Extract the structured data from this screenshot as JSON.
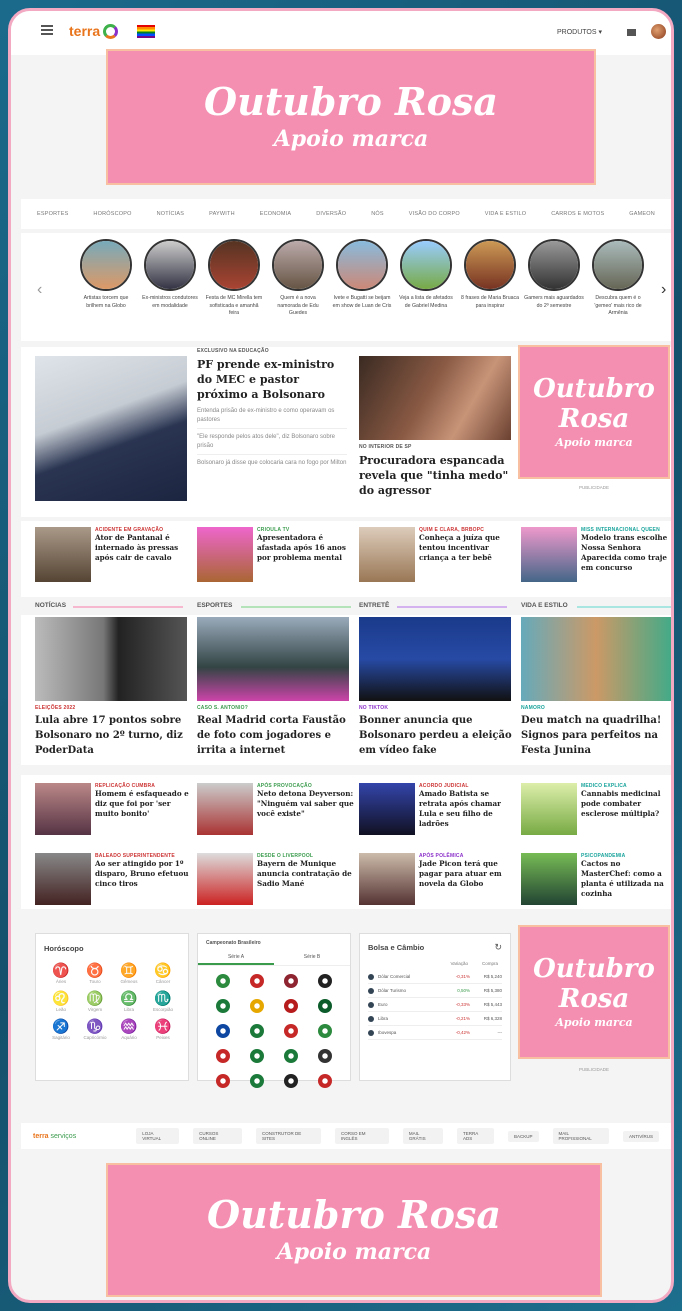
{
  "header": {
    "logo_text": "terra",
    "products_label": "PRODUTOS",
    "menu_icon": "hamburger-icon"
  },
  "promo": {
    "title": "Outubro Rosa",
    "subtitle": "Apoio marca"
  },
  "nav": [
    "ESPORTES",
    "HORÓSCOPO",
    "NOTÍCIAS",
    "PAYWITH",
    "ECONOMIA",
    "DIVERSÃO",
    "NÓS",
    "VISÃO DO CORPO",
    "VIDA E ESTILO",
    "CARROS E MOTOS",
    "GAMEON"
  ],
  "stories": [
    "Artistas torcem que brilhem na Globo",
    "Ex-ministros condutores em modalidade",
    "Festa de MC Mirella tem sofisticada e amanhã feira",
    "Quem é a nova namorada de Edu Guedes",
    "Ivete e Bugatti se beijam em show de Luan de Cris",
    "Veja a lista de afetados de Gabriel Medina",
    "8 frases de Maria Bruaca para inspirar",
    "Gamers mais aguardados do 2º semestre",
    "Descubra quem é o 'gemeo' mais rico de Armênia"
  ],
  "main": {
    "kicker": "EXCLUSIVO NA EDUCAÇÃO",
    "headline": "PF prende ex-ministro do MEC e pastor próximo a Bolsonaro",
    "bullets": [
      "Entenda prisão de ex-ministro e como operavam os pastores",
      "\"Ele responde pelos atos dele\", diz Bolsonaro sobre prisão",
      "Bolsonaro já disse que colocaria cara no fogo por Milton"
    ],
    "second_kicker": "NO INTERIOR DE SP",
    "second_headline": "Procuradora espancada revela que \"tinha medo\" do agressor",
    "ad_label": "PUBLICIDADE"
  },
  "row1": [
    {
      "kicker": "ACIDENTE EM GRAVAÇÃO",
      "title": "Ator de Pantanal é internado às pressas após cair de cavalo"
    },
    {
      "kicker": "CRIOULA TV",
      "title": "Apresentadora é afastada após 16 anos por problema mental"
    },
    {
      "kicker": "QUIM E CLARA, BRBOPC",
      "title": "Conheça a juíza que tentou incentivar criança a ter bebê"
    },
    {
      "kicker": "MISS INTERNACIONAL QUEEN",
      "title": "Modelo trans escolhe Nossa Senhora Aparecida como traje em concurso"
    }
  ],
  "sections": [
    "NOTÍCIAS",
    "ESPORTES",
    "ENTRETÊ",
    "VIDA E ESTILO"
  ],
  "features": [
    {
      "kicker": "ELEIÇÕES 2022",
      "title": "Lula abre 17 pontos sobre Bolsonaro no 2º turno, diz PoderData"
    },
    {
      "kicker": "CASO S. ANTONIO?",
      "title": "Real Madrid corta Faustão de foto com jogadores e irrita a internet"
    },
    {
      "kicker": "NO TIKTOK",
      "title": "Bonner anuncia que Bolsonaro perdeu a eleição em vídeo fake"
    },
    {
      "kicker": "NAMORO",
      "title": "Deu match na quadrilha! Signos para perfeitos na Festa Junina"
    }
  ],
  "row2": [
    {
      "kicker": "REPLICAÇÃO CUMBRA",
      "title": "Homem é esfaqueado e diz que foi por 'ser muito bonito'"
    },
    {
      "kicker": "APÓS PROVOCAÇÃO",
      "title": "Neto detona Deyverson: \"Ninguém vai saber que você existe\""
    },
    {
      "kicker": "ACORDO JUDICIAL",
      "title": "Amado Batista se retrata após chamar Lula e seu filho de ladrões"
    },
    {
      "kicker": "MEDICO EXPLICA",
      "title": "Cannabis medicinal pode combater esclerose múltipla?"
    }
  ],
  "row3": [
    {
      "kicker": "BALEADO SUPERINTENDENTE",
      "title": "Ao ser atingido por 1º disparo, Bruno efetuou cinco tiros"
    },
    {
      "kicker": "DESDE O LIVERPOOL",
      "title": "Bayern de Munique anuncia contratação de Sadio Mané"
    },
    {
      "kicker": "APÓS POLÊMICA",
      "title": "Jade Picon terá que pagar para atuar em novela da Globo"
    },
    {
      "kicker": "PSICOPANDEMIA",
      "title": "Cactos no MasterChef: como a planta é utilizada na cozinha"
    }
  ],
  "horoscope": {
    "title": "Horóscopo",
    "signs": [
      {
        "g": "♈",
        "n": "Áries"
      },
      {
        "g": "♉",
        "n": "Touro"
      },
      {
        "g": "♊",
        "n": "Gêmeos"
      },
      {
        "g": "♋",
        "n": "Câncer"
      },
      {
        "g": "♌",
        "n": "Leão"
      },
      {
        "g": "♍",
        "n": "Virgem"
      },
      {
        "g": "♎",
        "n": "Libra"
      },
      {
        "g": "♏",
        "n": "Escorpião"
      },
      {
        "g": "♐",
        "n": "Sagitário"
      },
      {
        "g": "♑",
        "n": "Capricórnio"
      },
      {
        "g": "♒",
        "n": "Aquário"
      },
      {
        "g": "♓",
        "n": "Peixes"
      }
    ]
  },
  "football": {
    "title": "Campeonato Brasileiro",
    "tab_a": "Série A",
    "tab_b": "Série B"
  },
  "market": {
    "title": "Bolsa e Câmbio",
    "col_var": "Variação",
    "col_buy": "Compra",
    "rows": [
      {
        "name": "Dólar Comercial",
        "var": "-0,31%",
        "buy": "R$ 5,240",
        "color": "#c33"
      },
      {
        "name": "Dólar Turismo",
        "var": "0,50%",
        "buy": "R$ 5,380",
        "color": "#3a9b4c"
      },
      {
        "name": "Euro",
        "var": "-0,33%",
        "buy": "R$ 5,443",
        "color": "#c33"
      },
      {
        "name": "Libra",
        "var": "-0,21%",
        "buy": "R$ 6,328",
        "color": "#c33"
      },
      {
        "name": "Ibovespa",
        "var": "-0,42%",
        "buy": "---",
        "color": "#c33"
      }
    ]
  },
  "footer": {
    "brand": "terra",
    "brand_suffix": "serviços",
    "links": [
      "LOJA VIRTUAL",
      "CURSOS ONLINE",
      "CONSTRUTOR DE SITES",
      "CORSO EM INGLÊS",
      "MAIL GRÁTIS",
      "TERRA ADS",
      "BACKUP",
      "MAIL PROFISSIONAL",
      "ANTIVÍRUS"
    ]
  },
  "colors": {
    "accent_pink": "#f48fb1",
    "terra_orange": "#e8741b",
    "link_blue": "#2a6ad1"
  }
}
